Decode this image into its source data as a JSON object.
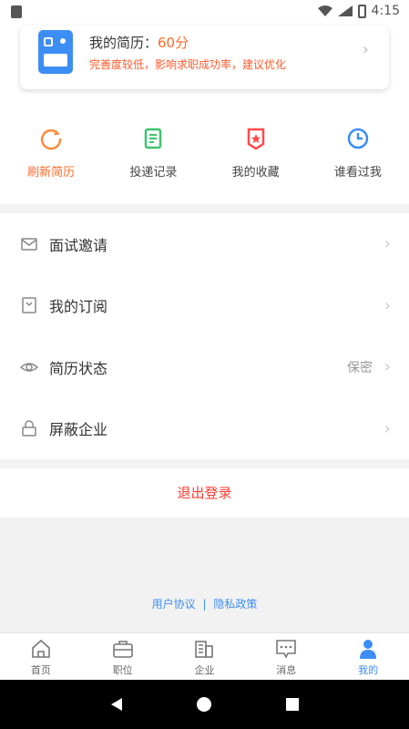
{
  "status_bar": {
    "time": "4:15"
  },
  "resume_card": {
    "title": "我的简历：",
    "score": "60分",
    "hint": "完善度较低，影响求职成功率，建议优化"
  },
  "quick_actions": [
    {
      "label": "刷新简历"
    },
    {
      "label": "投递记录"
    },
    {
      "label": "我的收藏"
    },
    {
      "label": "谁看过我"
    }
  ],
  "menu": [
    {
      "label": "面试邀请",
      "value": ""
    },
    {
      "label": "我的订阅",
      "value": ""
    },
    {
      "label": "简历状态",
      "value": "保密"
    },
    {
      "label": "屏蔽企业",
      "value": ""
    }
  ],
  "logout_label": "退出登录",
  "footer": {
    "user_agreement": "用户协议",
    "separator": "|",
    "privacy_policy": "隐私政策"
  },
  "tabs": [
    {
      "label": "首页"
    },
    {
      "label": "职位"
    },
    {
      "label": "企业"
    },
    {
      "label": "消息"
    },
    {
      "label": "我的"
    }
  ],
  "colors": {
    "accent": "#3d8ef4",
    "warning": "#ff6a2b",
    "danger": "#ff3b30"
  }
}
